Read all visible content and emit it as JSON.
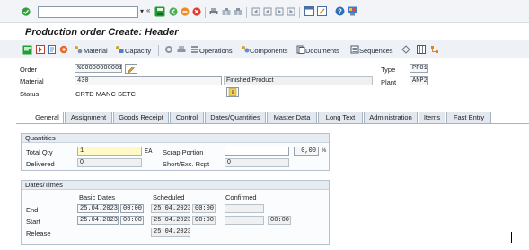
{
  "header": {
    "title": "Production order Create: Header"
  },
  "toolbar": {
    "material_label": "Material",
    "capacity_label": "Capacity",
    "operations_label": "Operations",
    "components_label": "Components",
    "documents_label": "Documents",
    "sequences_label": "Sequences"
  },
  "order_header": {
    "order_label": "Order",
    "order_value": "%00000000001",
    "type_label": "Type",
    "type_value": "PP01",
    "material_label": "Material",
    "material_value": "430",
    "material_desc": "Finished Product",
    "plant_label": "Plant",
    "plant_value": "ANP2",
    "status_label": "Status",
    "status_value": "CRTD MANC SETC"
  },
  "tabs": [
    {
      "label": "General"
    },
    {
      "label": "Assignment"
    },
    {
      "label": "Goods Receipt"
    },
    {
      "label": "Control"
    },
    {
      "label": "Dates/Quantities"
    },
    {
      "label": "Master Data"
    },
    {
      "label": "Long Text"
    },
    {
      "label": "Administration"
    },
    {
      "label": "Items"
    },
    {
      "label": "Fast Entry"
    }
  ],
  "quantities": {
    "title": "Quantities",
    "total_qty_label": "Total Qty",
    "total_qty_value": "1",
    "unit": "EA",
    "scrap_label": "Scrap Portion",
    "scrap_value": "",
    "scrap_pct": "0,00",
    "pct_sign": "%",
    "delivered_label": "Delivered",
    "delivered_value": "0",
    "short_label": "Short/Exc. Rcpt",
    "short_value": "0"
  },
  "dates": {
    "title": "Dates/Times",
    "col_basic": "Basic Dates",
    "col_scheduled": "Scheduled",
    "col_confirmed": "Confirmed",
    "end_label": "End",
    "end_basic_date": "25.04.2023",
    "end_basic_time": "00:00",
    "end_sched_date": "25.04.2023",
    "end_sched_time": "00:00",
    "start_label": "Start",
    "start_basic_date": "25.04.2023",
    "start_basic_time": "00:00",
    "start_sched_date": "25.04.2023",
    "start_sched_time": "00:00",
    "start_conf_time": "00:00",
    "release_label": "Release",
    "release_sched_date": "25.04.2023"
  },
  "colors": {
    "title_bar": "#f2f4f7",
    "toolbar": "#eef1f5",
    "group_header": "#e7ecf2",
    "required_field": "#fff9c8",
    "enter_icon": "#2e9d3a"
  }
}
